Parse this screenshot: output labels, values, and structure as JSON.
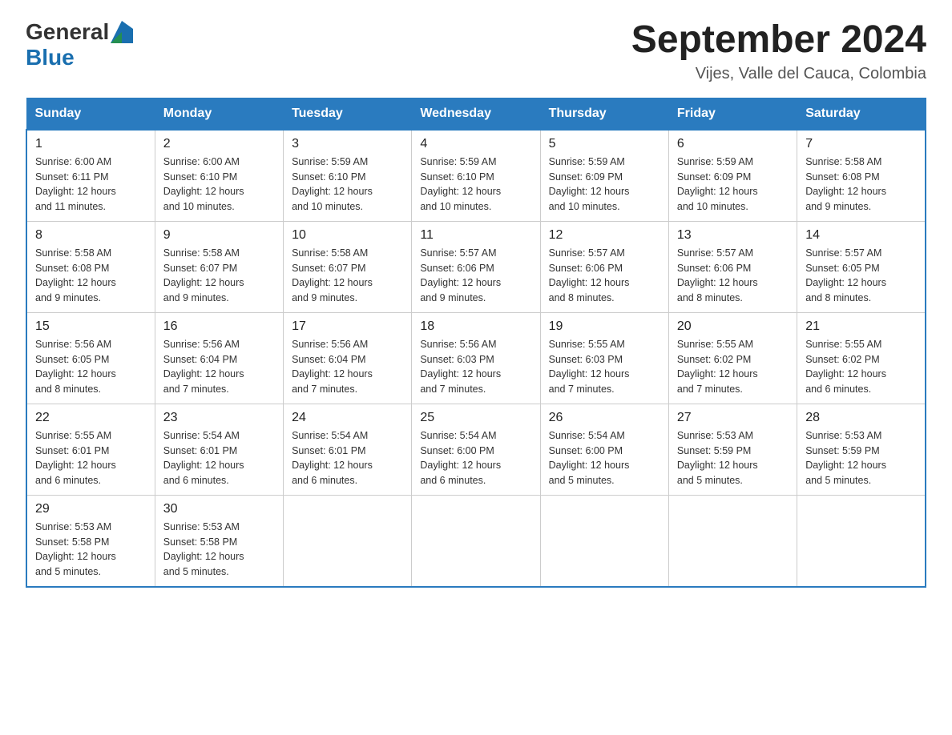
{
  "header": {
    "logo_general": "General",
    "logo_blue": "Blue",
    "title": "September 2024",
    "subtitle": "Vijes, Valle del Cauca, Colombia"
  },
  "days_of_week": [
    "Sunday",
    "Monday",
    "Tuesday",
    "Wednesday",
    "Thursday",
    "Friday",
    "Saturday"
  ],
  "weeks": [
    [
      {
        "day": "1",
        "sunrise": "6:00 AM",
        "sunset": "6:11 PM",
        "daylight": "12 hours and 11 minutes."
      },
      {
        "day": "2",
        "sunrise": "6:00 AM",
        "sunset": "6:10 PM",
        "daylight": "12 hours and 10 minutes."
      },
      {
        "day": "3",
        "sunrise": "5:59 AM",
        "sunset": "6:10 PM",
        "daylight": "12 hours and 10 minutes."
      },
      {
        "day": "4",
        "sunrise": "5:59 AM",
        "sunset": "6:10 PM",
        "daylight": "12 hours and 10 minutes."
      },
      {
        "day": "5",
        "sunrise": "5:59 AM",
        "sunset": "6:09 PM",
        "daylight": "12 hours and 10 minutes."
      },
      {
        "day": "6",
        "sunrise": "5:59 AM",
        "sunset": "6:09 PM",
        "daylight": "12 hours and 10 minutes."
      },
      {
        "day": "7",
        "sunrise": "5:58 AM",
        "sunset": "6:08 PM",
        "daylight": "12 hours and 9 minutes."
      }
    ],
    [
      {
        "day": "8",
        "sunrise": "5:58 AM",
        "sunset": "6:08 PM",
        "daylight": "12 hours and 9 minutes."
      },
      {
        "day": "9",
        "sunrise": "5:58 AM",
        "sunset": "6:07 PM",
        "daylight": "12 hours and 9 minutes."
      },
      {
        "day": "10",
        "sunrise": "5:58 AM",
        "sunset": "6:07 PM",
        "daylight": "12 hours and 9 minutes."
      },
      {
        "day": "11",
        "sunrise": "5:57 AM",
        "sunset": "6:06 PM",
        "daylight": "12 hours and 9 minutes."
      },
      {
        "day": "12",
        "sunrise": "5:57 AM",
        "sunset": "6:06 PM",
        "daylight": "12 hours and 8 minutes."
      },
      {
        "day": "13",
        "sunrise": "5:57 AM",
        "sunset": "6:06 PM",
        "daylight": "12 hours and 8 minutes."
      },
      {
        "day": "14",
        "sunrise": "5:57 AM",
        "sunset": "6:05 PM",
        "daylight": "12 hours and 8 minutes."
      }
    ],
    [
      {
        "day": "15",
        "sunrise": "5:56 AM",
        "sunset": "6:05 PM",
        "daylight": "12 hours and 8 minutes."
      },
      {
        "day": "16",
        "sunrise": "5:56 AM",
        "sunset": "6:04 PM",
        "daylight": "12 hours and 7 minutes."
      },
      {
        "day": "17",
        "sunrise": "5:56 AM",
        "sunset": "6:04 PM",
        "daylight": "12 hours and 7 minutes."
      },
      {
        "day": "18",
        "sunrise": "5:56 AM",
        "sunset": "6:03 PM",
        "daylight": "12 hours and 7 minutes."
      },
      {
        "day": "19",
        "sunrise": "5:55 AM",
        "sunset": "6:03 PM",
        "daylight": "12 hours and 7 minutes."
      },
      {
        "day": "20",
        "sunrise": "5:55 AM",
        "sunset": "6:02 PM",
        "daylight": "12 hours and 7 minutes."
      },
      {
        "day": "21",
        "sunrise": "5:55 AM",
        "sunset": "6:02 PM",
        "daylight": "12 hours and 6 minutes."
      }
    ],
    [
      {
        "day": "22",
        "sunrise": "5:55 AM",
        "sunset": "6:01 PM",
        "daylight": "12 hours and 6 minutes."
      },
      {
        "day": "23",
        "sunrise": "5:54 AM",
        "sunset": "6:01 PM",
        "daylight": "12 hours and 6 minutes."
      },
      {
        "day": "24",
        "sunrise": "5:54 AM",
        "sunset": "6:01 PM",
        "daylight": "12 hours and 6 minutes."
      },
      {
        "day": "25",
        "sunrise": "5:54 AM",
        "sunset": "6:00 PM",
        "daylight": "12 hours and 6 minutes."
      },
      {
        "day": "26",
        "sunrise": "5:54 AM",
        "sunset": "6:00 PM",
        "daylight": "12 hours and 5 minutes."
      },
      {
        "day": "27",
        "sunrise": "5:53 AM",
        "sunset": "5:59 PM",
        "daylight": "12 hours and 5 minutes."
      },
      {
        "day": "28",
        "sunrise": "5:53 AM",
        "sunset": "5:59 PM",
        "daylight": "12 hours and 5 minutes."
      }
    ],
    [
      {
        "day": "29",
        "sunrise": "5:53 AM",
        "sunset": "5:58 PM",
        "daylight": "12 hours and 5 minutes."
      },
      {
        "day": "30",
        "sunrise": "5:53 AM",
        "sunset": "5:58 PM",
        "daylight": "12 hours and 5 minutes."
      },
      null,
      null,
      null,
      null,
      null
    ]
  ]
}
